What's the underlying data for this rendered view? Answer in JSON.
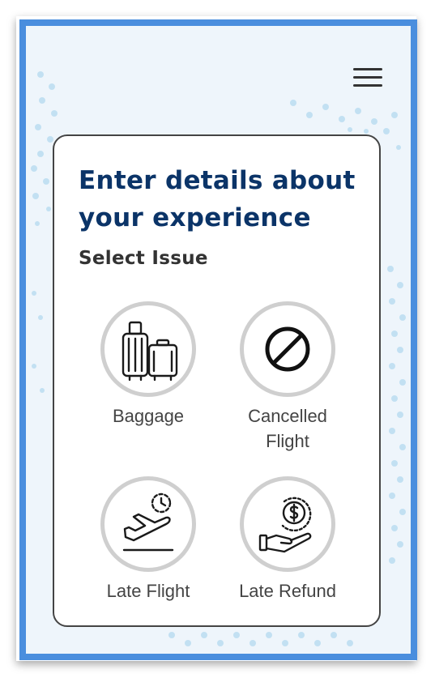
{
  "form": {
    "title": "Enter details about your experience",
    "section_label": "Select Issue"
  },
  "issues": [
    {
      "label": "Baggage",
      "icon": "baggage-icon"
    },
    {
      "label": "Cancelled Flight",
      "icon": "cancelled-icon"
    },
    {
      "label": "Late Flight",
      "icon": "late-flight-icon"
    },
    {
      "label": "Late Refund",
      "icon": "late-refund-icon"
    }
  ],
  "header": {
    "menu_icon": "hamburger-menu-icon"
  },
  "colors": {
    "frame_border": "#4a8ede",
    "title": "#0b3468",
    "background": "#eef5fb"
  }
}
